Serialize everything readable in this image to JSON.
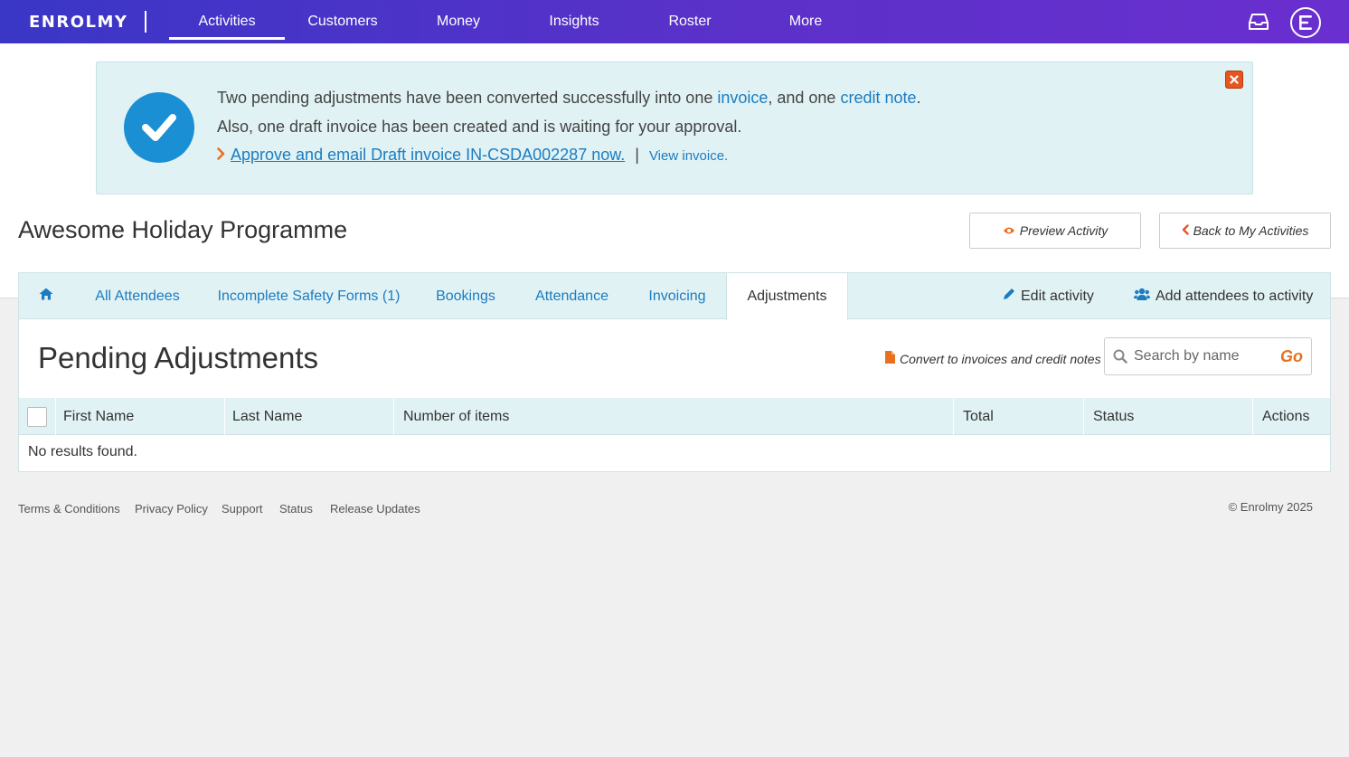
{
  "topnav": {
    "logo": "ENROLMY",
    "items": [
      {
        "label": "Activities",
        "active": true
      },
      {
        "label": "Customers"
      },
      {
        "label": "Money"
      },
      {
        "label": "Insights"
      },
      {
        "label": "Roster"
      },
      {
        "label": "More"
      }
    ],
    "icons": [
      "inbox-icon",
      "profile-icon"
    ]
  },
  "alert": {
    "line1_prefix": "Two pending adjustments have been converted successfully into one ",
    "line1_link1": "invoice",
    "line1_mid": ", and one ",
    "line1_link2": "credit note",
    "line1_suffix": ".",
    "line2": "Also, one draft invoice has been created and is waiting for your approval.",
    "approve_link": "Approve and email Draft invoice IN-CSDA002287 now.",
    "separator": "|",
    "view_link": "View invoice."
  },
  "page": {
    "title": "Awesome Holiday Programme",
    "preview_button": "Preview Activity",
    "back_button": "Back to My Activities"
  },
  "tabs": {
    "items": [
      {
        "label": "All Attendees"
      },
      {
        "label": "Incomplete Safety Forms (1)"
      },
      {
        "label": "Bookings"
      },
      {
        "label": "Attendance"
      },
      {
        "label": "Invoicing"
      },
      {
        "label": "Adjustments",
        "active": true
      }
    ],
    "edit_activity": "Edit activity",
    "add_attendees": "Add attendees to activity"
  },
  "section": {
    "title": "Pending Adjustments",
    "convert_link": "Convert to invoices and credit notes",
    "search_placeholder": "Search by name",
    "go_label": "Go"
  },
  "table": {
    "columns": [
      "First Name",
      "Last Name",
      "Number of items",
      "Total",
      "Status",
      "Actions"
    ],
    "empty_message": "No results found."
  },
  "footer": {
    "links": [
      "Terms & Conditions",
      "Privacy Policy",
      "Support",
      "Status",
      "Release Updates"
    ],
    "copyright": "© Enrolmy 2025"
  },
  "colors": {
    "link": "#1c7cc1",
    "accent_orange": "#e8701e",
    "alert_bg": "#e1f2f4",
    "check_blue": "#1a8fd4"
  }
}
